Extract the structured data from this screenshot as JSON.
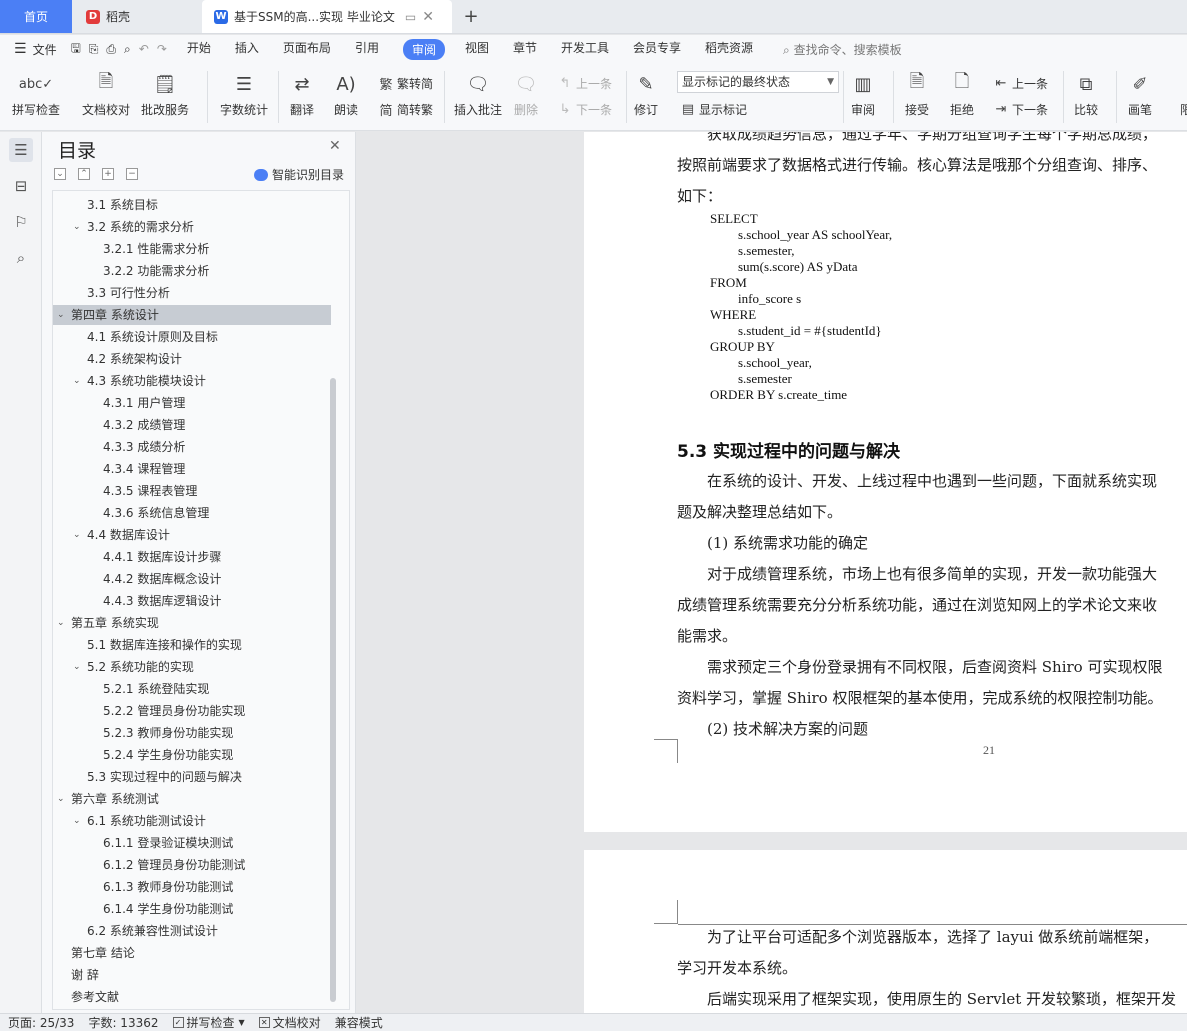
{
  "tabs": {
    "home": "首页",
    "daoke": "稻壳",
    "doc": "基于SSM的高...实现 毕业论文"
  },
  "menu": {
    "file": "文件",
    "items": [
      "开始",
      "插入",
      "页面布局",
      "引用",
      "审阅",
      "视图",
      "章节",
      "开发工具",
      "会员专享",
      "稻壳资源"
    ],
    "active": "审阅",
    "search": "查找命令、搜索模板"
  },
  "ribbon": {
    "spellcheck": "拼写检查",
    "doc_proof": "文档校对",
    "annotation_service": "批改服务",
    "word_count": "字数统计",
    "translate": "翻译",
    "read_aloud": "朗读",
    "trad": "繁转简",
    "simp": "简转繁",
    "insert_comment": "插入批注",
    "delete": "删除",
    "prev": "上一条",
    "next": "下一条",
    "revise": "修订",
    "markup_state": "显示标记的最终状态",
    "show_markup": "显示标记",
    "review": "审阅",
    "accept": "接受",
    "reject": "拒绝",
    "prev2": "上一条",
    "next2": "下一条",
    "compare": "比较",
    "pen": "画笔",
    "limit": "限"
  },
  "toc": {
    "title": "目录",
    "smart": "智能识别目录",
    "items": [
      {
        "label": "3.1  系统目标",
        "level": 2,
        "expand": ""
      },
      {
        "label": "3.2  系统的需求分析",
        "level": 2,
        "expand": "v"
      },
      {
        "label": "3.2.1  性能需求分析",
        "level": 3,
        "expand": ""
      },
      {
        "label": "3.2.2  功能需求分析",
        "level": 3,
        "expand": ""
      },
      {
        "label": "3.3  可行性分析",
        "level": 2,
        "expand": ""
      },
      {
        "label": "第四章  系统设计",
        "level": 1,
        "expand": "v",
        "selected": true
      },
      {
        "label": "4.1  系统设计原则及目标",
        "level": 2,
        "expand": ""
      },
      {
        "label": "4.2  系统架构设计",
        "level": 2,
        "expand": ""
      },
      {
        "label": "4.3  系统功能模块设计",
        "level": 2,
        "expand": "v"
      },
      {
        "label": "4.3.1  用户管理",
        "level": 3,
        "expand": ""
      },
      {
        "label": "4.3.2  成绩管理",
        "level": 3,
        "expand": ""
      },
      {
        "label": "4.3.3  成绩分析",
        "level": 3,
        "expand": ""
      },
      {
        "label": "4.3.4  课程管理",
        "level": 3,
        "expand": ""
      },
      {
        "label": "4.3.5  课程表管理",
        "level": 3,
        "expand": ""
      },
      {
        "label": "4.3.6  系统信息管理",
        "level": 3,
        "expand": ""
      },
      {
        "label": "4.4  数据库设计",
        "level": 2,
        "expand": "v"
      },
      {
        "label": "4.4.1  数据库设计步骤",
        "level": 3,
        "expand": ""
      },
      {
        "label": "4.4.2  数据库概念设计",
        "level": 3,
        "expand": ""
      },
      {
        "label": "4.4.3  数据库逻辑设计",
        "level": 3,
        "expand": ""
      },
      {
        "label": "第五章  系统实现",
        "level": 1,
        "expand": "v"
      },
      {
        "label": "5.1  数据库连接和操作的实现",
        "level": 2,
        "expand": ""
      },
      {
        "label": "5.2  系统功能的实现",
        "level": 2,
        "expand": "v"
      },
      {
        "label": "5.2.1  系统登陆实现",
        "level": 3,
        "expand": ""
      },
      {
        "label": "5.2.2  管理员身份功能实现",
        "level": 3,
        "expand": ""
      },
      {
        "label": "5.2.3  教师身份功能实现",
        "level": 3,
        "expand": ""
      },
      {
        "label": "5.2.4  学生身份功能实现",
        "level": 3,
        "expand": ""
      },
      {
        "label": "5.3  实现过程中的问题与解决",
        "level": 2,
        "expand": ""
      },
      {
        "label": "第六章  系统测试",
        "level": 1,
        "expand": "v"
      },
      {
        "label": "6.1  系统功能测试设计",
        "level": 2,
        "expand": "v"
      },
      {
        "label": "6.1.1  登录验证模块测试",
        "level": 3,
        "expand": ""
      },
      {
        "label": "6.1.2  管理员身份功能测试",
        "level": 3,
        "expand": ""
      },
      {
        "label": "6.1.3  教师身份功能测试",
        "level": 3,
        "expand": ""
      },
      {
        "label": "6.1.4  学生身份功能测试",
        "level": 3,
        "expand": ""
      },
      {
        "label": "6.2  系统兼容性测试设计",
        "level": 2,
        "expand": ""
      },
      {
        "label": "第七章  结论",
        "level": 1,
        "expand": ""
      },
      {
        "label": "谢  辞",
        "level": 1,
        "expand": ""
      },
      {
        "label": "参考文献",
        "level": 1,
        "expand": ""
      }
    ]
  },
  "page1": {
    "line1": "获取成绩趋势信息，通过学年、学期分组查询学生每个学期总成绩，",
    "line2": "按照前端要求了数据格式进行传输。核心算法是哦那个分组查询、排序、",
    "line3": "如下：",
    "code": [
      "SELECT",
      "s.school_year AS schoolYear,",
      "s.semester,",
      "sum(s.score) AS yData",
      "FROM",
      "info_score s",
      "WHERE",
      "s.student_id = #{studentId}",
      "GROUP BY",
      "s.school_year,",
      "s.semester",
      "ORDER BY s.create_time"
    ],
    "heading": "5.3  实现过程中的问题与解决",
    "p1a": "在系统的设计、开发、上线过程中也遇到一些问题，下面就系统实现",
    "p1b": "题及解决整理总结如下。",
    "item1": "(1) 系统需求功能的确定",
    "p2a": "对于成绩管理系统，市场上也有很多简单的实现，开发一款功能强大",
    "p2b": "成绩管理系统需要充分分析系统功能，通过在浏览知网上的学术论文来收",
    "p2c": "能需求。",
    "p3a": "需求预定三个身份登录拥有不同权限，后查阅资料 Shiro 可实现权限",
    "p3b": "资料学习，掌握 Shiro 权限框架的基本使用，完成系统的权限控制功能。",
    "item2": "(2) 技术解决方案的问题",
    "pagenum": "21"
  },
  "page2": {
    "l1": "为了让平台可适配多个浏览器版本，选择了 layui 做系统前端框架，",
    "l2": "学习开发本系统。",
    "l3": "后端实现采用了框架实现，使用原生的 Servlet 开发较繁琐，框架开发"
  },
  "status": {
    "page": "页面: 25/33",
    "words": "字数: 13362",
    "spell": "拼写检查",
    "proof": "文档校对",
    "compat": "兼容模式"
  }
}
